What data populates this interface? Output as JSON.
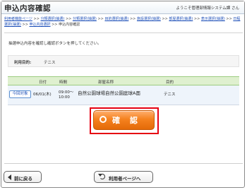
{
  "header": {
    "title": "申込内容確認",
    "welcome": "ようこそ管理部情報システム課 さん"
  },
  "breadcrumb": {
    "items": [
      "利用者機能ページ",
      "分類選択(抽選)",
      "分類選択(抽選)",
      "目的選択(抽選)",
      "施設選択(抽選)",
      "部屋選択(抽選)",
      "表示選択(抽選)",
      "日程選択(抽選)",
      "申込内容選択"
    ],
    "current": "申込内容確認",
    "separator": ">>"
  },
  "instruction": "抽選申込内容を確認し確認ボタンを押してください。",
  "purpose": {
    "label": "利用目的:",
    "value": "テニス"
  },
  "table": {
    "headers": [
      "日付",
      "時間",
      "部屋名称",
      "目的"
    ],
    "rows": [
      {
        "badge": "今回対象",
        "date": "06/01(木)",
        "time": "09:00～ 10:00",
        "room": "自然公園球場自然公園庭球A面",
        "purpose": "テニス"
      }
    ]
  },
  "confirm_button": {
    "label": "確 認"
  },
  "footer": {
    "back_label": "前に戻る",
    "user_page_label": "利用者ページへ"
  },
  "colors": {
    "accent_orange": "#f5821f",
    "highlight_red": "#e60012",
    "table_header_green": "#dff0cf",
    "link_blue": "#1d4fb8"
  },
  "icons": [
    "circle-icon",
    "back-arrow-icon",
    "return-icon"
  ]
}
